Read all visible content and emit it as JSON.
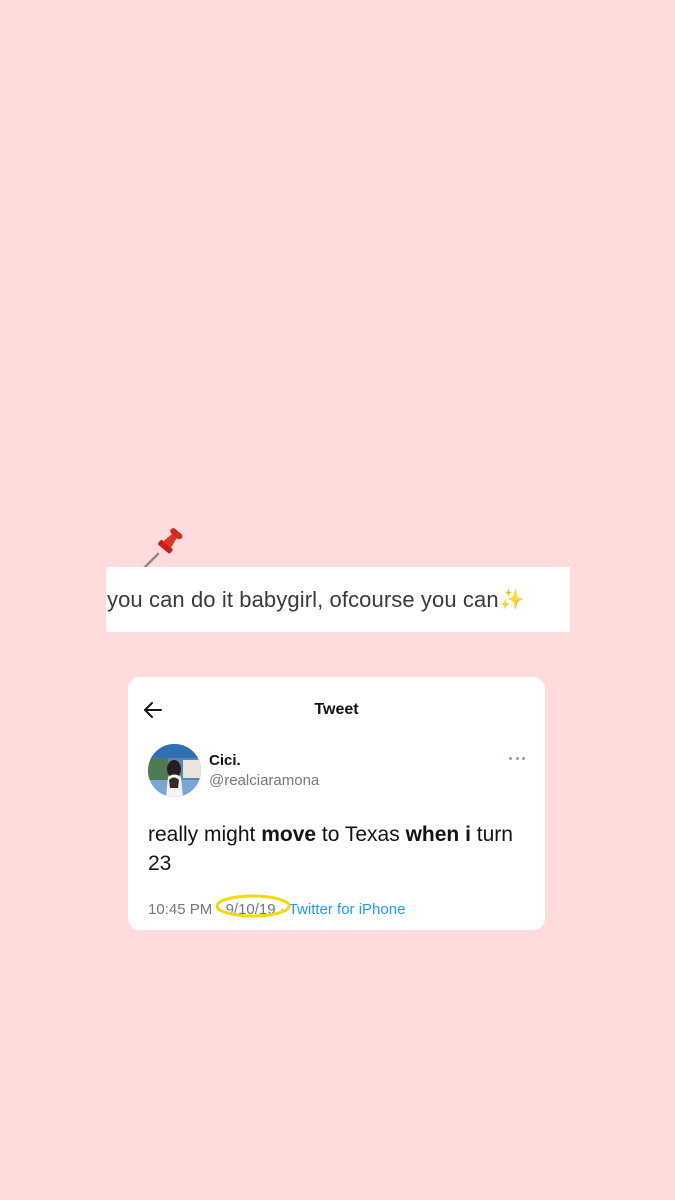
{
  "caption": {
    "text": "you can do it babygirl, ofcourse you can",
    "sparkle_glyph": "✨",
    "pushpin_icon": "pushpin-icon"
  },
  "tweet_header": {
    "back_icon": "arrow-left-icon",
    "title": "Tweet"
  },
  "author": {
    "display_name": "Cici.",
    "handle": "@realciaramona"
  },
  "tweet": {
    "text_segments": [
      {
        "text": "really might ",
        "bold": false
      },
      {
        "text": "move",
        "bold": true
      },
      {
        "text": " to Texas ",
        "bold": false
      },
      {
        "text": "when i",
        "bold": true
      },
      {
        "text": " turn 23",
        "bold": false
      }
    ],
    "time": "10:45 PM",
    "separator": "·",
    "date": "9/10/19",
    "source": "Twitter for iPhone"
  },
  "colors": {
    "background": "#ffdcdb",
    "link": "#1d9bf0",
    "highlight_ring": "#f5d90a"
  }
}
